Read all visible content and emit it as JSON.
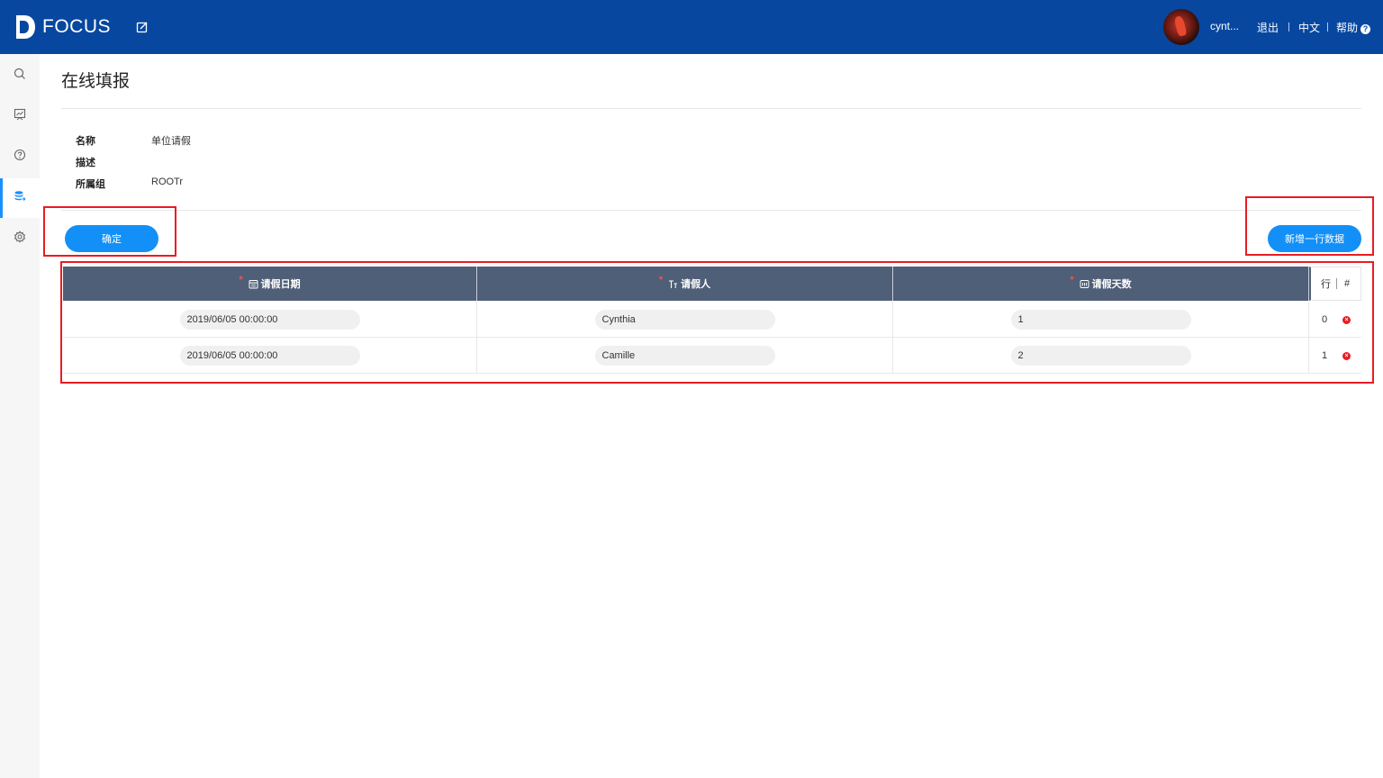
{
  "header": {
    "logo_text": "FOCUS",
    "username": "cynt...",
    "logout": "退出",
    "language": "中文",
    "help": "帮助",
    "help_icon_glyph": "?"
  },
  "sidebar": {
    "items": [
      {
        "icon": "search-icon"
      },
      {
        "icon": "dashboard-icon"
      },
      {
        "icon": "question-icon"
      },
      {
        "icon": "database-icon",
        "active": true
      },
      {
        "icon": "gear-icon"
      }
    ]
  },
  "page": {
    "title": "在线填报",
    "meta": {
      "name_label": "名称",
      "name_value": "单位请假",
      "desc_label": "描述",
      "desc_value": "",
      "group_label": "所属组",
      "group_value": "ROOTr"
    },
    "confirm_label": "确定",
    "add_row_label": "新增一行数据"
  },
  "table": {
    "required_mark": "*",
    "columns": [
      {
        "label": "请假日期",
        "icon": "calendar-icon"
      },
      {
        "label": "请假人",
        "icon": "text-icon"
      },
      {
        "label": "请假天数",
        "icon": "number-icon"
      }
    ],
    "row_col_label": "行",
    "action_col_label": "#",
    "rows": [
      {
        "date": "2019/06/05 00:00:00",
        "person": "Cynthia",
        "days": "1",
        "index": "0"
      },
      {
        "date": "2019/06/05 00:00:00",
        "person": "Camille",
        "days": "2",
        "index": "1"
      }
    ],
    "delete_glyph": "×"
  },
  "colors": {
    "header_bg": "#0747a0",
    "primary_button": "#1290f8",
    "table_header_bg": "#4f5f77",
    "highlight_box": "#e81c24"
  }
}
